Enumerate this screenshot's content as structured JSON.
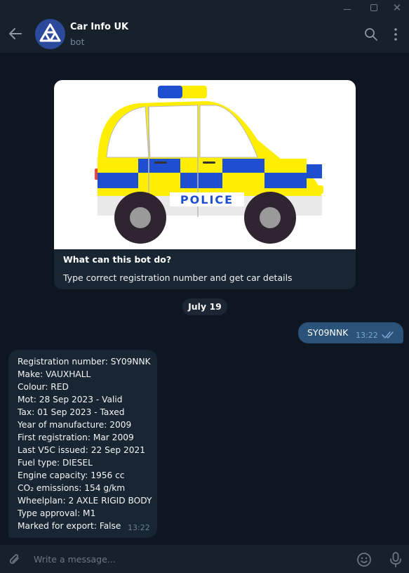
{
  "window": {
    "minimize_icon": "minimize-icon",
    "maximize_icon": "maximize-icon",
    "close_icon": "close-icon"
  },
  "header": {
    "title": "Car Info UK",
    "subtitle": "bot",
    "icons": [
      "back-arrow-icon",
      "search-icon",
      "more-vertical-icon"
    ]
  },
  "bot_info": {
    "image": "police-car-illustration",
    "image_text": "POLICE",
    "title": "What can this bot do?",
    "description": "Type correct registration number and get car details"
  },
  "date_separator": "July 19",
  "messages": {
    "outgoing": {
      "text": "SY09NNK",
      "time": "13:22",
      "status": "read"
    },
    "incoming": {
      "lines": [
        "Registration number: SY09NNK",
        "Make: VAUXHALL",
        "Colour: RED",
        "Mot: 28 Sep 2023 - Valid",
        "Tax: 01 Sep 2023 - Taxed",
        "Year of manufacture: 2009",
        "First registration: Mar 2009",
        "Last V5C issued: 22 Sep 2021",
        "Fuel type: DIESEL",
        "Engine capacity: 1956 cc",
        "CO₂ emissions: 154 g/km",
        "Wheelplan: 2 AXLE RIGID BODY",
        "Type approval: M1",
        "Marked for export: False"
      ],
      "time": "13:22"
    }
  },
  "composer": {
    "placeholder": "Write a message...",
    "value": "",
    "icons": [
      "attach-icon",
      "emoji-icon",
      "microphone-icon"
    ]
  },
  "colors": {
    "background": "#0e1621",
    "panel": "#17212b",
    "incoming_bubble": "#182533",
    "outgoing_bubble": "#2b5278",
    "police_blue": "#1f4fd1",
    "police_yellow": "#ffee00"
  }
}
